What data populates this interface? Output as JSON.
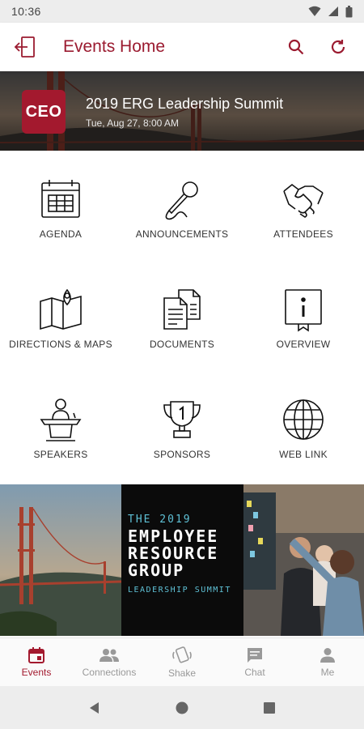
{
  "status_bar": {
    "time": "10:36"
  },
  "app_bar": {
    "title": "Events Home"
  },
  "event": {
    "logo_text": "CEO",
    "title": "2019 ERG Leadership Summit",
    "date": "Tue, Aug 27, 8:00 AM"
  },
  "tiles": [
    {
      "label": "AGENDA",
      "icon": "calendar-icon"
    },
    {
      "label": "ANNOUNCEMENTS",
      "icon": "microphone-icon"
    },
    {
      "label": "ATTENDEES",
      "icon": "handshake-icon"
    },
    {
      "label": "DIRECTIONS & MAPS",
      "icon": "map-icon"
    },
    {
      "label": "DOCUMENTS",
      "icon": "documents-icon"
    },
    {
      "label": "OVERVIEW",
      "icon": "info-icon"
    },
    {
      "label": "SPEAKERS",
      "icon": "speaker-podium-icon"
    },
    {
      "label": "SPONSORS",
      "icon": "trophy-icon"
    },
    {
      "label": "WEB LINK",
      "icon": "globe-icon"
    }
  ],
  "promo": {
    "line1": "THE 2019",
    "line2": "EMPLOYEE",
    "line3": "RESOURCE",
    "line4": "GROUP",
    "line5": "LEADERSHIP SUMMIT"
  },
  "bottom_nav": [
    {
      "label": "Events",
      "icon": "calendar-icon",
      "active": true
    },
    {
      "label": "Connections",
      "icon": "people-icon",
      "active": false
    },
    {
      "label": "Shake",
      "icon": "shake-icon",
      "active": false
    },
    {
      "label": "Chat",
      "icon": "chat-icon",
      "active": false
    },
    {
      "label": "Me",
      "icon": "person-icon",
      "active": false
    }
  ],
  "colors": {
    "brand": "#9b1b30",
    "logo_bg": "#a3192e",
    "inactive": "#999999"
  }
}
